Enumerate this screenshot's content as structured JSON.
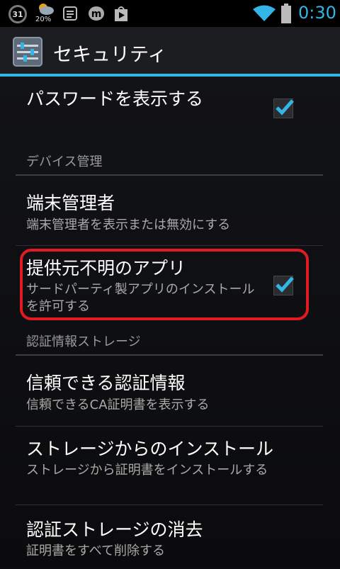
{
  "status_bar": {
    "calendar_day": "31",
    "weather_temp": "20%",
    "time": "0:30",
    "icons": [
      "calendar-icon",
      "weather-icon",
      "news-icon",
      "m-app-icon",
      "play-store-icon",
      "wifi-icon",
      "battery-icon"
    ]
  },
  "action_bar": {
    "title": "セキュリティ",
    "icon": "settings-icon",
    "accent_color": "#33b5e5"
  },
  "preferences": {
    "show_password": {
      "title": "パスワードを表示する",
      "checked": true
    },
    "category_device": "デバイス管理",
    "device_admin": {
      "title": "端末管理者",
      "summary": "端末管理者を表示または無効にする"
    },
    "unknown_sources": {
      "title": "提供元不明のアプリ",
      "summary": "サードパーティ製アプリのインストールを許可する",
      "checked": true
    },
    "category_credentials": "認証情報ストレージ",
    "trusted_credentials": {
      "title": "信頼できる認証情報",
      "summary": "信頼できるCA証明書を表示する"
    },
    "install_from_storage": {
      "title": "ストレージからのインストール",
      "summary": "ストレージから証明書をインストールする"
    },
    "clear_credentials": {
      "title": "認証ストレージの消去",
      "summary": "証明書をすべて削除する"
    }
  },
  "highlight_color": "#e11a23"
}
